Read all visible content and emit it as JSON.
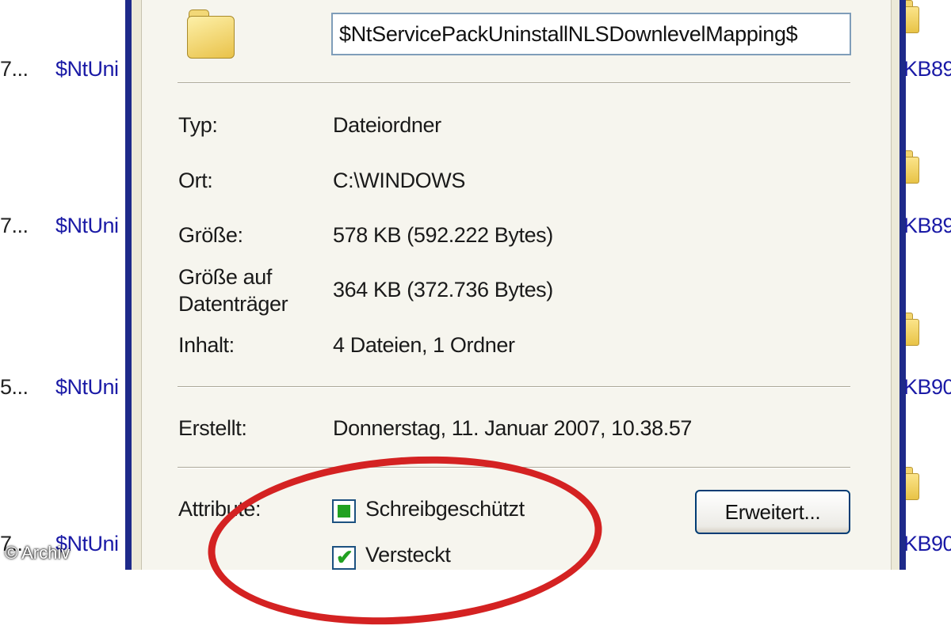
{
  "background_list": {
    "rows": [
      {
        "num": "7...",
        "name": "$NtUni",
        "kb": "KB89"
      },
      {
        "num": "7...",
        "name": "$NtUni",
        "kb": "KB89"
      },
      {
        "num": "5...",
        "name": "$NtUni",
        "kb": "KB90"
      },
      {
        "num": "7...",
        "name": "$NtUni",
        "kb": "KB90"
      }
    ]
  },
  "dialog": {
    "folder_name": "$NtServicePackUninstallNLSDownlevelMapping$",
    "folder_icon": "folder-icon",
    "properties": {
      "type_label": "Typ:",
      "type_value": "Dateiordner",
      "location_label": "Ort:",
      "location_value": "C:\\WINDOWS",
      "size_label": "Größe:",
      "size_value": "578 KB (592.222 Bytes)",
      "size_on_disk_label_line1": "Größe auf",
      "size_on_disk_label_line2": "Datenträger",
      "size_on_disk_value": "364 KB (372.736 Bytes)",
      "contents_label": "Inhalt:",
      "contents_value": "4 Dateien, 1 Ordner",
      "created_label": "Erstellt:",
      "created_value": "Donnerstag, 11. Januar 2007, 10.38.57"
    },
    "attributes": {
      "label": "Attribute:",
      "readonly_label": "Schreibgeschützt",
      "readonly_state": "indeterminate",
      "hidden_label": "Versteckt",
      "hidden_state": "checked",
      "advanced_button": "Erweitert..."
    }
  },
  "annotation": {
    "color": "#d42222"
  },
  "watermark": "© Archiv"
}
